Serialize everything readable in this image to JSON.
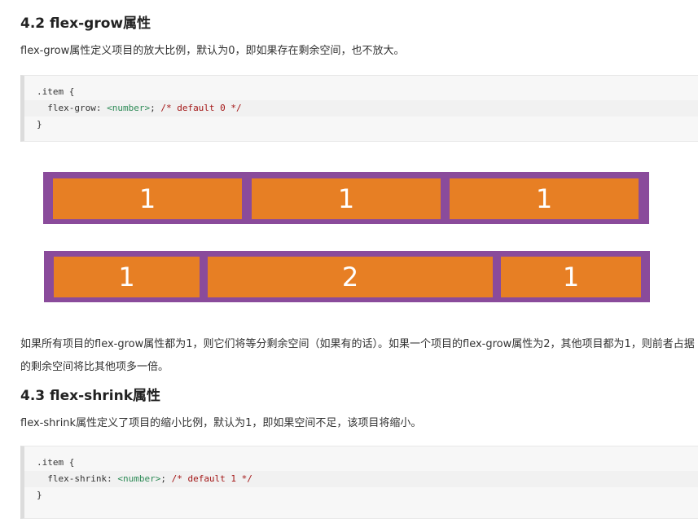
{
  "section1": {
    "heading": "4.2 flex-grow属性",
    "desc": "flex-grow属性定义项目的放大比例，默认为0，即如果存在剩余空间，也不放大。",
    "code": {
      "selector": ".item {",
      "prop": "  flex-grow: ",
      "value": "<number>",
      "semi": "; ",
      "comment": "/* default 0 */",
      "close": "}"
    }
  },
  "demo1": {
    "items": [
      "1",
      "1",
      "1"
    ],
    "grow": [
      1,
      1,
      1
    ]
  },
  "demo2": {
    "items": [
      "1",
      "2",
      "1"
    ],
    "grow": [
      1,
      2,
      1
    ]
  },
  "explanation": "如果所有项目的flex-grow属性都为1，则它们将等分剩余空间（如果有的话）。如果一个项目的flex-grow属性为2，其他项目都为1，则前者占据的剩余空间将比其他项多一倍。",
  "section2": {
    "heading": "4.3 flex-shrink属性",
    "desc": "flex-shrink属性定义了项目的缩小比例，默认为1，即如果空间不足，该项目将缩小。",
    "code": {
      "selector": ".item {",
      "prop": "  flex-shrink: ",
      "value": "<number>",
      "semi": "; ",
      "comment": "/* default 1 */",
      "close": "}"
    }
  },
  "colors": {
    "container": "#8a4b9b",
    "item": "#e77f24",
    "code_bg": "#f7f7f7"
  }
}
